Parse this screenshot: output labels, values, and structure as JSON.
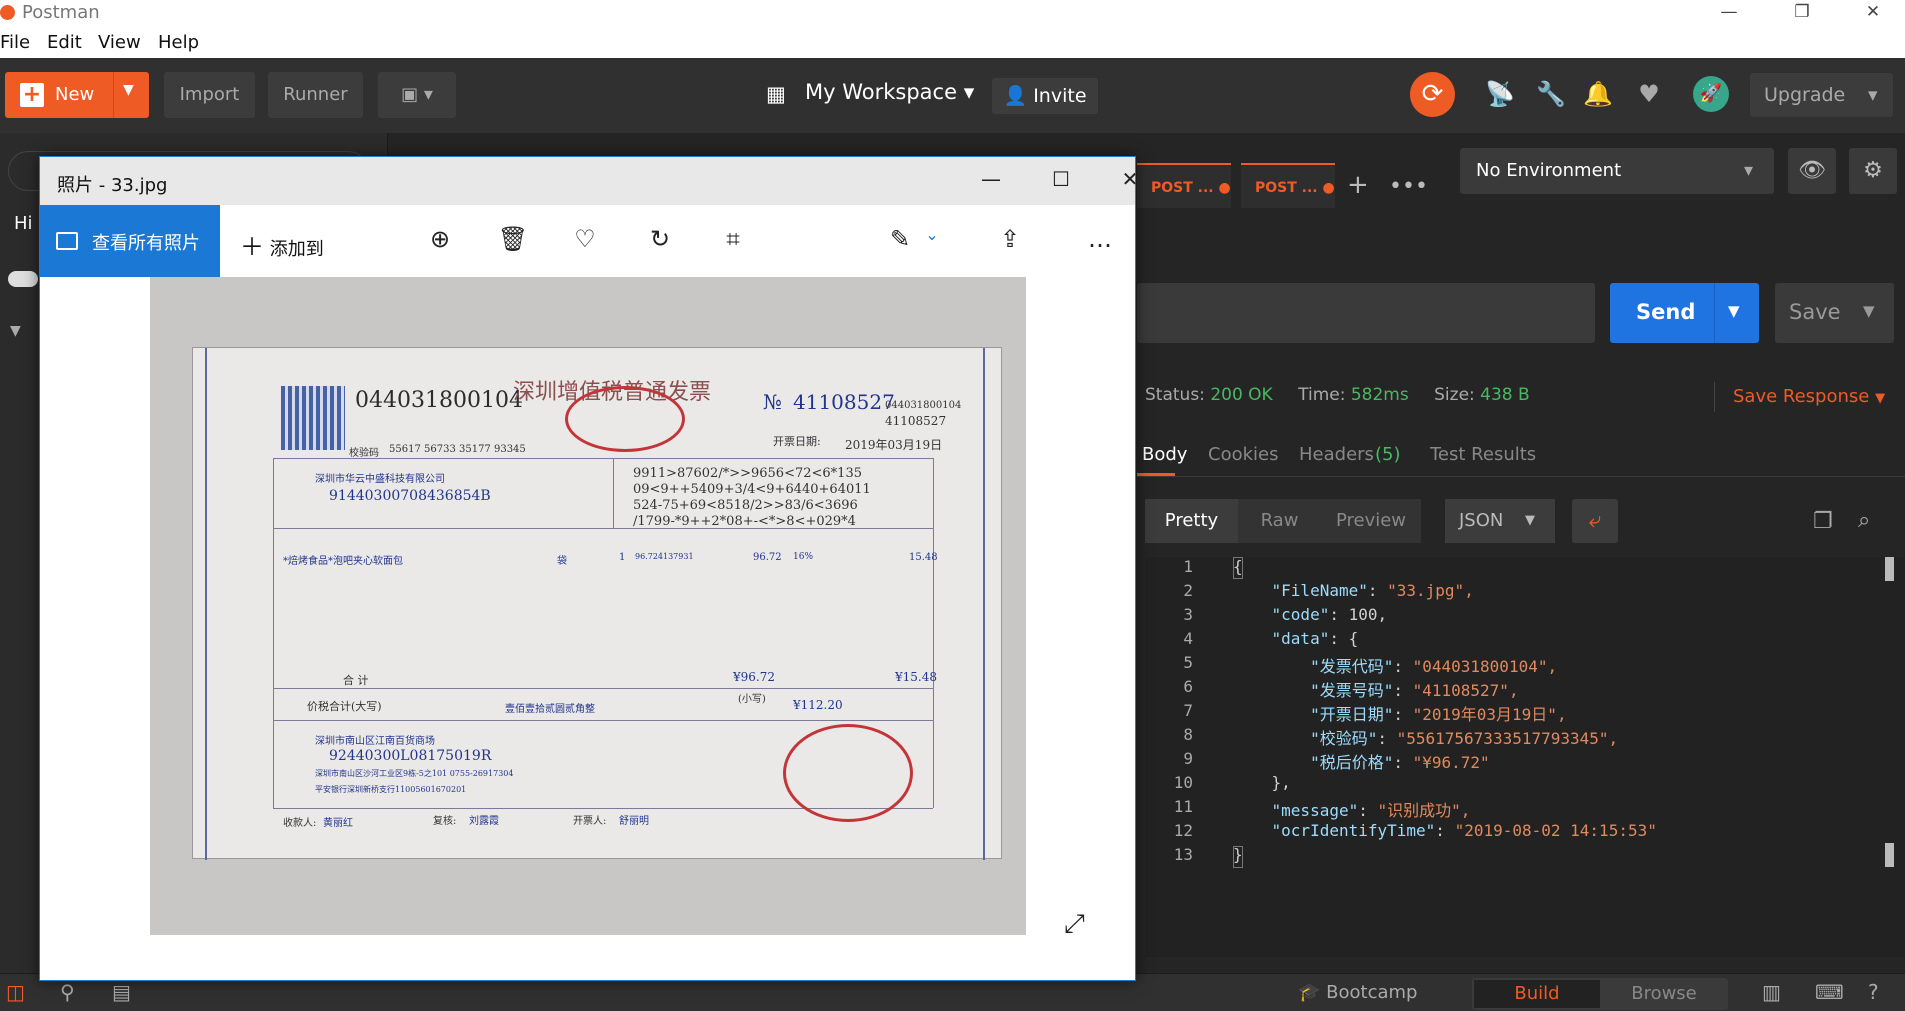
{
  "window": {
    "title": "Postman"
  },
  "menu": [
    "File",
    "Edit",
    "View",
    "Help"
  ],
  "header": {
    "new_label": "New",
    "import_label": "Import",
    "runner_label": "Runner",
    "workspace_label": "My Workspace",
    "invite_label": "Invite",
    "upgrade_label": "Upgrade"
  },
  "request": {
    "tabs": [
      {
        "method": "POST",
        "label": "POST ..."
      },
      {
        "method": "POST",
        "label": "POST ..."
      }
    ],
    "environment": "No Environment",
    "send_label": "Send",
    "save_label": "Save"
  },
  "response": {
    "status_label": "Status:",
    "status_value": "200 OK",
    "time_label": "Time:",
    "time_value": "582ms",
    "size_label": "Size:",
    "size_value": "438 B",
    "save_response_label": "Save Response",
    "tabs": [
      "Body",
      "Cookies",
      "Headers",
      "(5)",
      "Test Results"
    ],
    "views": [
      "Pretty",
      "Raw",
      "Preview"
    ],
    "format": "JSON",
    "lines": [
      "{",
      "    \"FileName\": \"33.jpg\",",
      "    \"code\": 100,",
      "    \"data\": {",
      "        \"发票代码\": \"044031800104\",",
      "        \"发票号码\": \"41108527\",",
      "        \"开票日期\": \"2019年03月19日\",",
      "        \"校验码\": \"55617567333517793345\",",
      "        \"税后价格\": \"¥96.72\"",
      "    },",
      "    \"message\": \"识别成功\",",
      "    \"ocrIdentifyTime\": \"2019-08-02 14:15:53\"",
      "}"
    ]
  },
  "footer": {
    "bootcamp_label": "Bootcamp",
    "build_label": "Build",
    "browse_label": "Browse"
  },
  "photos": {
    "title": "照片 - 33.jpg",
    "view_all_label": "查看所有照片",
    "add_to_label": "添加到",
    "invoice": {
      "code": "044031800104",
      "title": "深圳增值税普通发票",
      "number_prefix": "№",
      "number": "41108527",
      "date_label": "开票日期:",
      "date": "2019年03月19日",
      "check_code_label": "校验码",
      "check_code": "55617 56733 35177 93345",
      "buyer_name": "深圳市华云中盛科技有限公司",
      "buyer_taxid": "91440300708436854B",
      "cipher_lines": [
        "9911>87602/*>>9656<72<6*135",
        "09<9++5409+3/4<9+6440+64011",
        "524-75+69<8518/2>>83/6<3696",
        "/1799-*9++2*08+-<*>8<+029*4"
      ],
      "item_name": "*焙烤食品*泡吧夹心软面包",
      "unit": "袋",
      "qty": "1",
      "unit_price": "96.724137931",
      "amount": "96.72",
      "tax_rate": "16%",
      "tax": "15.48",
      "total_label": "合    计",
      "total_amount": "¥96.72",
      "total_tax": "¥15.48",
      "grand_label": "价税合计(大写)",
      "grand_words": "壹佰壹拾贰圆贰角整",
      "small_label": "(小写)",
      "grand_total": "¥112.20",
      "seller_name": "深圳市南山区江南百货商场",
      "seller_taxid": "92440300L08175019R",
      "seller_addr": "深圳市南山区沙河工业区9栋-5之101 0755-26917304",
      "seller_bank": "平安银行深圳新桥支行11005601670201",
      "payee_label": "收款人:",
      "payee": "黄丽红",
      "review_label": "复核:",
      "reviewer": "刘露霞",
      "drawer_label": "开票人:",
      "drawer": "舒丽明"
    }
  }
}
